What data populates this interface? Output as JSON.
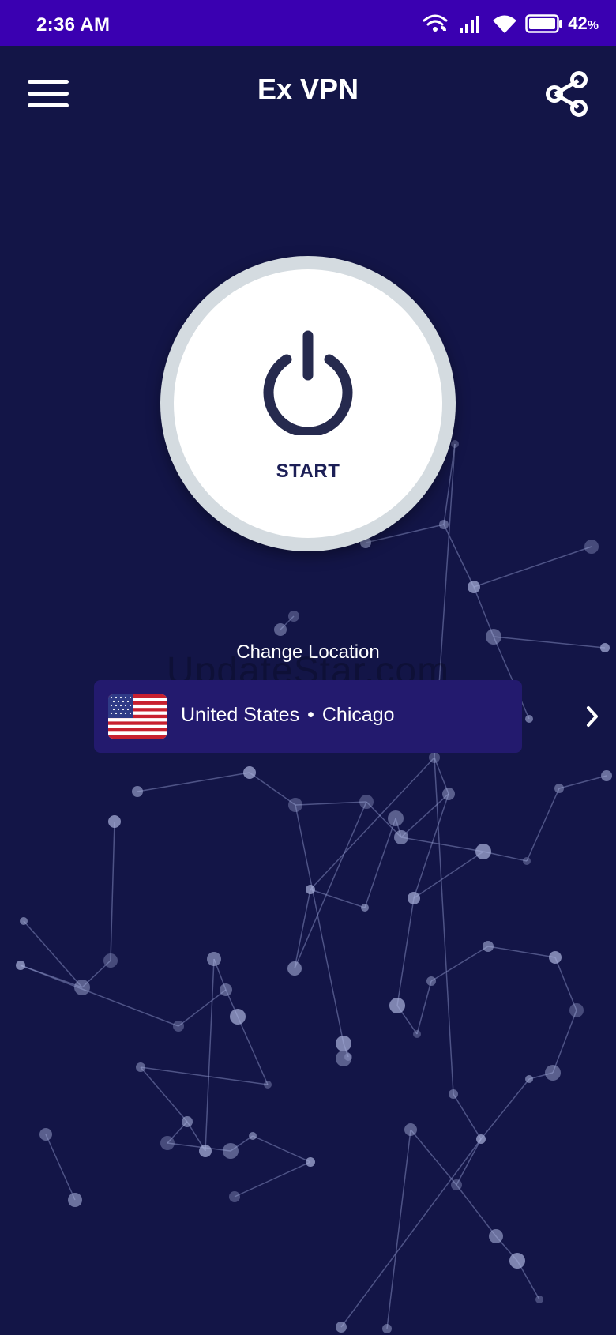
{
  "status_bar": {
    "time": "2:36 AM",
    "battery_percent": "42",
    "battery_unit": "%",
    "icons": [
      "wifi-calling-icon",
      "signal-icon",
      "wifi-icon",
      "battery-icon"
    ]
  },
  "app_bar": {
    "title": "Ex VPN",
    "menu_icon": "hamburger-menu-icon",
    "share_icon": "share-icon"
  },
  "connect_button": {
    "label": "START",
    "icon": "power-icon"
  },
  "location": {
    "heading": "Change Location",
    "country": "United States",
    "separator": "•",
    "city": "Chicago",
    "flag_icon": "us-flag-icon",
    "chevron_icon": "chevron-right-icon"
  },
  "watermark": "UpdateStar.com",
  "colors": {
    "background": "#131547",
    "status_bar": "#3a00b1",
    "location_card": "#231a6e",
    "button_text": "#1c1f56"
  }
}
